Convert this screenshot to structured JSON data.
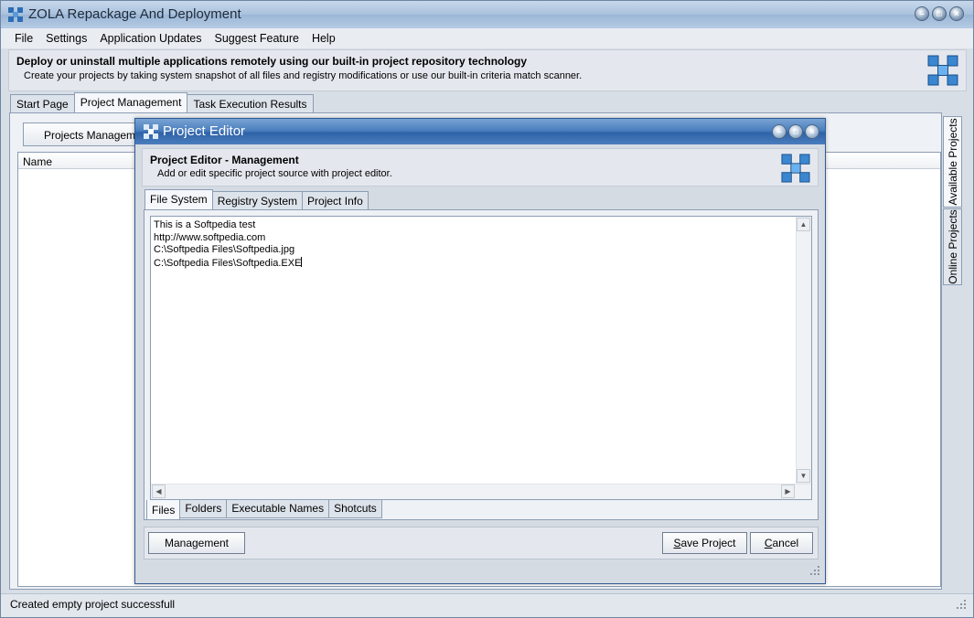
{
  "window": {
    "title": "ZOLA Repackage And Deployment"
  },
  "menu": {
    "items": [
      "File",
      "Settings",
      "Application Updates",
      "Suggest Feature",
      "Help"
    ]
  },
  "banner": {
    "title": "Deploy or uninstall multiple applications remotely using our built-in project repository technology",
    "subtitle": "Create your projects by taking system snapshot of all files and registry modifications or use our built-in criteria match scanner."
  },
  "tabs": [
    "Start Page",
    "Project Management",
    "Task Execution Results"
  ],
  "panel": {
    "projects_button": "Projects Management",
    "column_name": "Name"
  },
  "side_tabs": [
    "Available Projects",
    "Online Projects"
  ],
  "status": {
    "text": "Created empty project successfull"
  },
  "dialog": {
    "title": "Project Editor",
    "banner_title": "Project Editor - Management",
    "banner_subtitle": "Add or edit specific project source with project editor.",
    "tabs": [
      "File System",
      "Registry System",
      "Project Info"
    ],
    "editor_lines": [
      "This is a Softpedia test",
      "http://www.softpedia.com",
      "C:\\Softpedia Files\\Softpedia.jpg",
      "C:\\Softpedia Files\\Softpedia.EXE"
    ],
    "bottom_tabs": [
      "Files",
      "Folders",
      "Executable Names",
      "Shotcuts"
    ],
    "management_button": "Management",
    "save_button_ul": "S",
    "save_button_rest": "ave Project",
    "cancel_button_ul": "C",
    "cancel_button_rest": "ancel"
  }
}
